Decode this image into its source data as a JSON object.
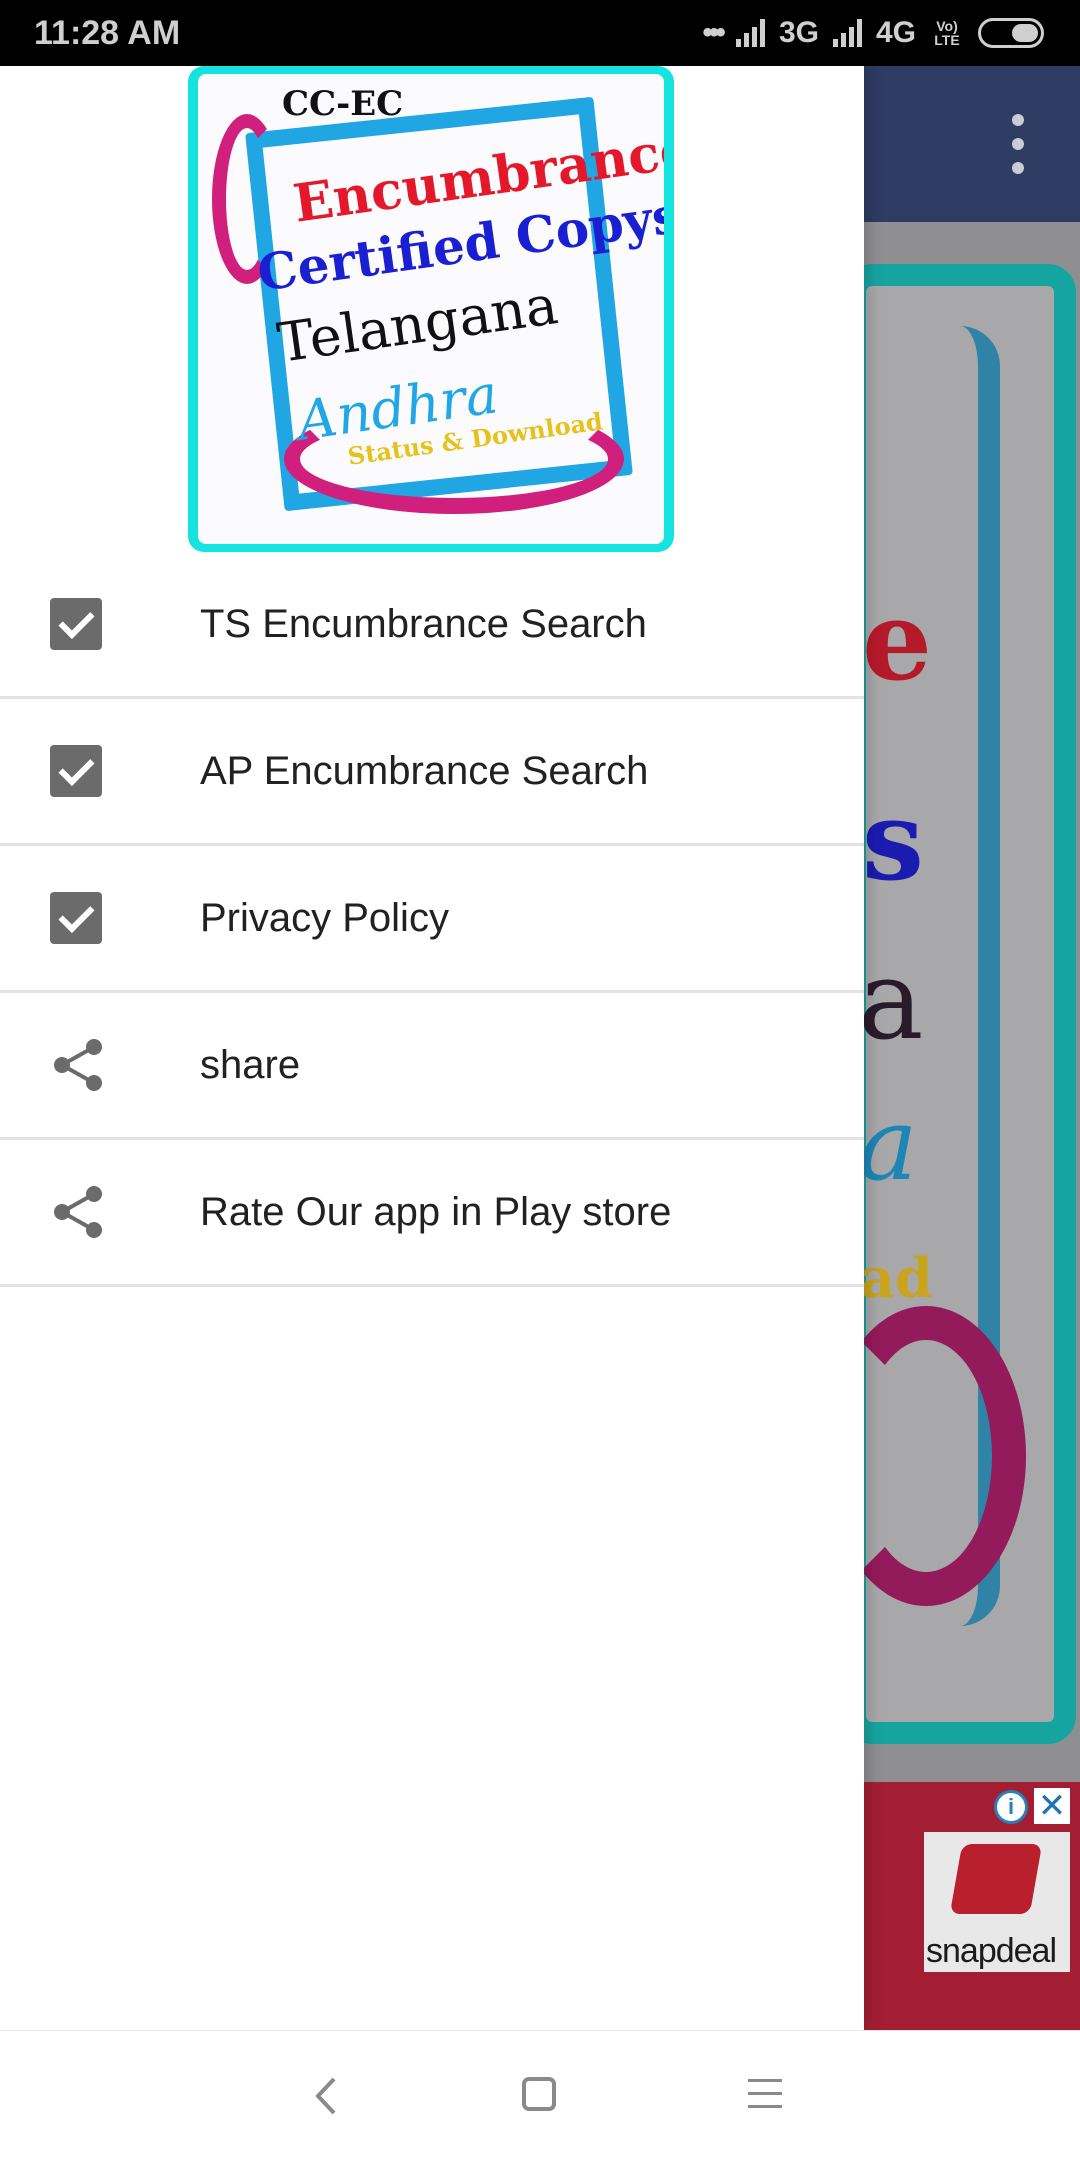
{
  "status_bar": {
    "time": "11:28 AM",
    "network_3g": "3G",
    "network_4g": "4G",
    "volte": "Vo) LTE",
    "icons": [
      "dots-icon",
      "signal-icon",
      "signal-icon",
      "battery-icon"
    ]
  },
  "drawer": {
    "logo": {
      "line1": "CC-EC",
      "line2": "Encumbrance",
      "line3": "Certified Copys",
      "line4": "Telangana",
      "line5": "Andhra",
      "line6": "Status & Download"
    },
    "items": [
      {
        "label": "TS Encumbrance Search",
        "icon": "checkbox-icon"
      },
      {
        "label": "AP Encumbrance Search",
        "icon": "checkbox-icon"
      },
      {
        "label": "Privacy Policy",
        "icon": "checkbox-icon"
      },
      {
        "label": "share",
        "icon": "share-icon"
      },
      {
        "label": "Rate Our app in Play store",
        "icon": "share-icon"
      }
    ]
  },
  "background_app": {
    "toolbar_menu_icon": "overflow-menu-icon",
    "ad": {
      "brand": "snapdeal",
      "info": "i",
      "close": "✕"
    }
  },
  "colors": {
    "toolbar": "#2f3b63",
    "logo_border": "#14e3df",
    "checkbox": "#6b6b6b",
    "ad_background": "#a31e32"
  }
}
